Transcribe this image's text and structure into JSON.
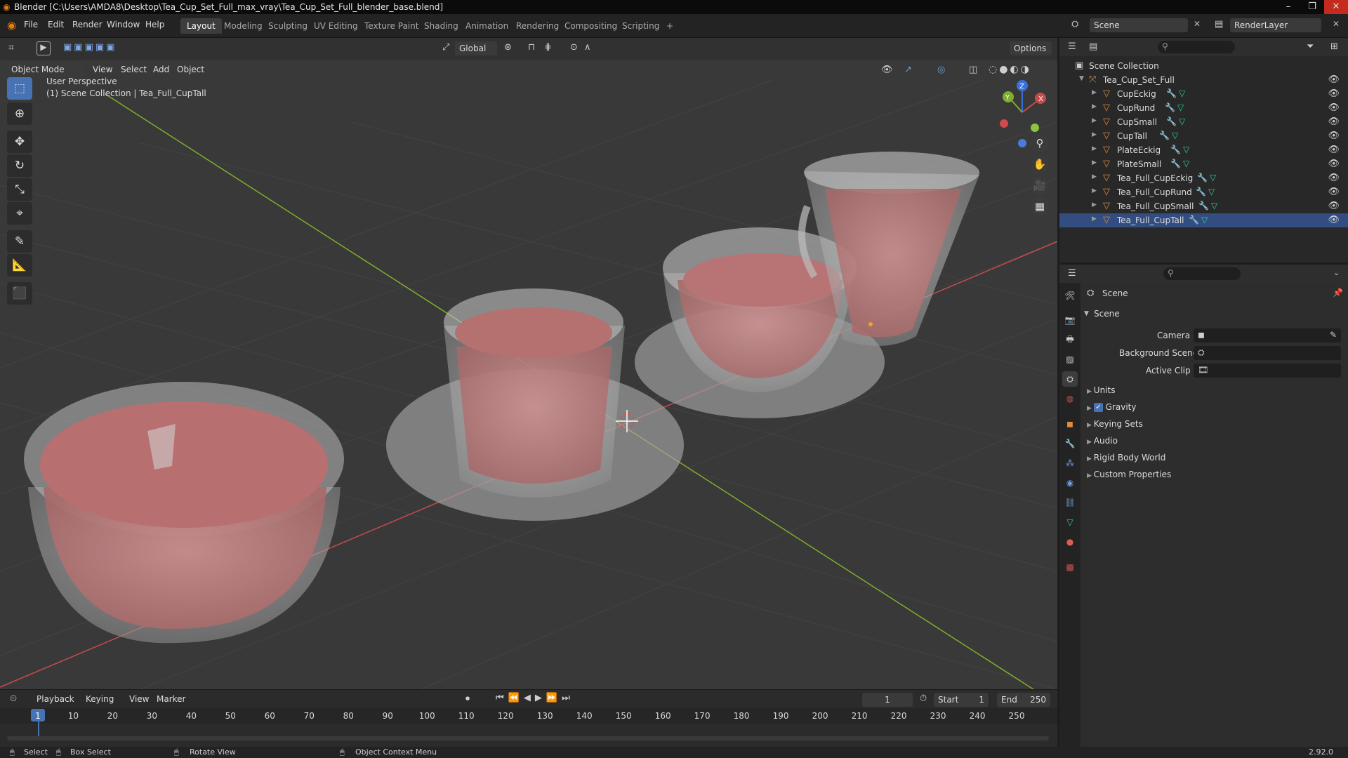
{
  "window": {
    "title": "Blender [C:\\Users\\AMDA8\\Desktop\\Tea_Cup_Set_Full_max_vray\\Tea_Cup_Set_Full_blender_base.blend]",
    "minimize": "–",
    "maximize": "❐",
    "close": "✕"
  },
  "menu": {
    "file": "File",
    "edit": "Edit",
    "render": "Render",
    "window": "Window",
    "help": "Help"
  },
  "workspaces": [
    "Layout",
    "Modeling",
    "Sculpting",
    "UV Editing",
    "Texture Paint",
    "Shading",
    "Animation",
    "Rendering",
    "Compositing",
    "Scripting"
  ],
  "workspace_add": "+",
  "scene_selector": {
    "value": "Scene"
  },
  "render_layer": {
    "value": "RenderLayer"
  },
  "viewport": {
    "transform_orientation": "Global",
    "options_label": "Options",
    "mode": "Object Mode",
    "menus": [
      "View",
      "Select",
      "Add",
      "Object"
    ],
    "perspective_label": "User Perspective",
    "collection_label": "(1) Scene Collection | Tea_Full_CupTall",
    "gizmo": {
      "x": "X",
      "y": "Y",
      "z": "Z"
    }
  },
  "outliner": {
    "root": "Scene Collection",
    "collection": "Tea_Cup_Set_Full",
    "objects": [
      "CupEckig",
      "CupRund",
      "CupSmall",
      "CupTall",
      "PlateEckig",
      "PlateSmall",
      "Tea_Full_CupEckig",
      "Tea_Full_CupRund",
      "Tea_Full_CupSmall",
      "Tea_Full_CupTall"
    ],
    "search_placeholder": ""
  },
  "properties": {
    "context": "Scene",
    "section": "Scene",
    "camera_label": "Camera",
    "background_scene_label": "Background Scene",
    "active_clip_label": "Active Clip",
    "panels": [
      "Units",
      "Gravity",
      "Keying Sets",
      "Audio",
      "Rigid Body World",
      "Custom Properties"
    ],
    "gravity_checked": true
  },
  "timeline": {
    "menus": [
      "Playback",
      "Keying",
      "View",
      "Marker"
    ],
    "current_frame": "1",
    "start_label": "Start",
    "start_value": "1",
    "end_label": "End",
    "end_value": "250",
    "ruler": [
      "1",
      "10",
      "20",
      "30",
      "40",
      "50",
      "60",
      "70",
      "80",
      "90",
      "100",
      "110",
      "120",
      "130",
      "140",
      "150",
      "160",
      "170",
      "180",
      "190",
      "200",
      "210",
      "220",
      "230",
      "240",
      "250"
    ]
  },
  "statusbar": {
    "select": "Select",
    "box_select": "Box Select",
    "rotate_view": "Rotate View",
    "context_menu": "Object Context Menu",
    "version": "2.92.0"
  },
  "colors": {
    "accent": "#4772b3",
    "x_axis": "#c64b4b",
    "y_axis": "#7fae2e",
    "z_axis": "#3d6fd6",
    "object": "#e38a3c",
    "mesh": "#2fcf9b"
  }
}
